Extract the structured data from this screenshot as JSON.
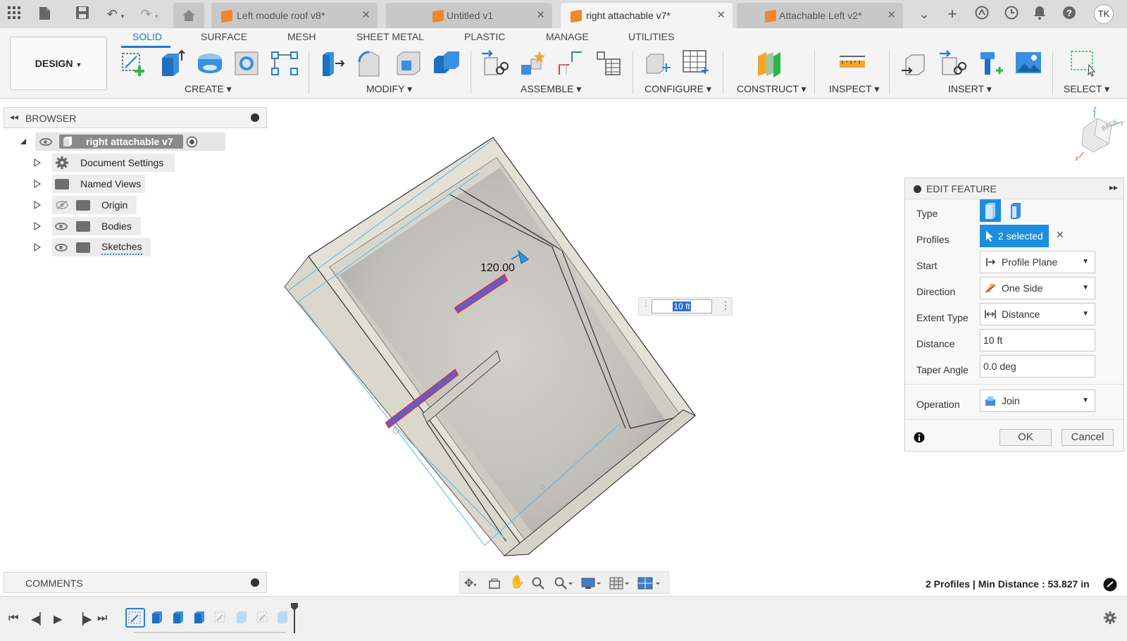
{
  "tabs": [
    {
      "label": "Left module roof v8*",
      "active": false
    },
    {
      "label": "Untitled v1",
      "active": false
    },
    {
      "label": "right attachable v7*",
      "active": true
    },
    {
      "label": "Attachable Left v2*",
      "active": false
    }
  ],
  "user_initials": "TK",
  "workspace": "DESIGN",
  "ribbon_tabs": [
    "SOLID",
    "SURFACE",
    "MESH",
    "SHEET METAL",
    "PLASTIC",
    "MANAGE",
    "UTILITIES"
  ],
  "ribbon_groups": [
    "CREATE",
    "MODIFY",
    "ASSEMBLE",
    "CONFIGURE",
    "CONSTRUCT",
    "INSPECT",
    "INSERT",
    "SELECT"
  ],
  "browser": {
    "title": "BROWSER",
    "root": "right attachable v7",
    "items": [
      "Document Settings",
      "Named Views",
      "Origin",
      "Bodies",
      "Sketches"
    ]
  },
  "viewport": {
    "dimension_label": "120.00",
    "distance_input": "10 ft",
    "viewcube_face": "BACK"
  },
  "edit_feature": {
    "title": "EDIT FEATURE",
    "type_label": "Type",
    "profiles_label": "Profiles",
    "profiles_value": "2 selected",
    "start_label": "Start",
    "start_value": "Profile Plane",
    "direction_label": "Direction",
    "direction_value": "One Side",
    "extent_label": "Extent Type",
    "extent_value": "Distance",
    "distance_label": "Distance",
    "distance_value": "10 ft",
    "taper_label": "Taper Angle",
    "taper_value": "0.0 deg",
    "operation_label": "Operation",
    "operation_value": "Join",
    "ok": "OK",
    "cancel": "Cancel"
  },
  "comments_title": "COMMENTS",
  "status_text": "2 Profiles | Min Distance : 53.827 in",
  "colors": {
    "accent": "#1d8ede",
    "tab_bg": "#dcdcdc",
    "cube_orange": "#f2862a"
  }
}
